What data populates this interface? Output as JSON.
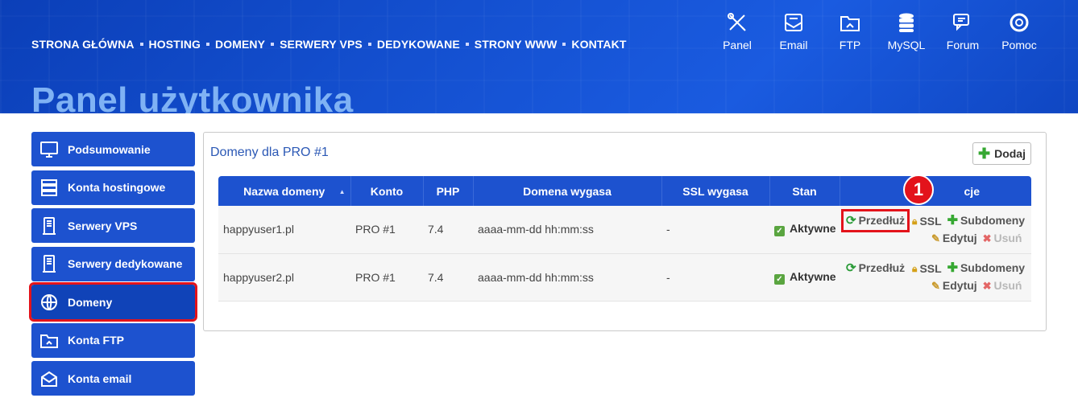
{
  "topnav": {
    "items": [
      "STRONA GŁÓWNA",
      "HOSTING",
      "DOMENY",
      "SERWERY VPS",
      "DEDYKOWANE",
      "STRONY WWW",
      "KONTAKT"
    ]
  },
  "tools": {
    "items": [
      {
        "label": "Panel",
        "icon": "tools-icon"
      },
      {
        "label": "Email",
        "icon": "email-icon"
      },
      {
        "label": "FTP",
        "icon": "ftp-folder-icon"
      },
      {
        "label": "MySQL",
        "icon": "database-icon"
      },
      {
        "label": "Forum",
        "icon": "forum-icon"
      },
      {
        "label": "Pomoc",
        "icon": "lifebuoy-icon"
      }
    ]
  },
  "page": {
    "title": "Panel użytkownika"
  },
  "sidebar": {
    "items": [
      {
        "label": "Podsumowanie",
        "icon": "monitor-icon"
      },
      {
        "label": "Konta hostingowe",
        "icon": "server-stack-icon"
      },
      {
        "label": "Serwery VPS",
        "icon": "server-icon"
      },
      {
        "label": "Serwery dedykowane",
        "icon": "server-icon"
      },
      {
        "label": "Domeny",
        "icon": "www-globe-icon",
        "active": true
      },
      {
        "label": "Konta FTP",
        "icon": "ftp-folder-icon"
      },
      {
        "label": "Konta email",
        "icon": "mail-open-icon"
      }
    ]
  },
  "panel": {
    "title": "Domeny dla PRO #1",
    "add_label": "Dodaj"
  },
  "table": {
    "headers": [
      "Nazwa domeny",
      "Konto",
      "PHP",
      "Domena wygasa",
      "SSL wygasa",
      "Stan",
      "cje"
    ],
    "rows": [
      {
        "domain": "happyuser1.pl",
        "account": "PRO #1",
        "php": "7.4",
        "expires": "aaaa-mm-dd hh:mm:ss",
        "ssl": "-",
        "status": "Aktywne"
      },
      {
        "domain": "happyuser2.pl",
        "account": "PRO #1",
        "php": "7.4",
        "expires": "aaaa-mm-dd hh:mm:ss",
        "ssl": "-",
        "status": "Aktywne"
      }
    ],
    "actions": {
      "renew": "Przedłuż",
      "ssl": "SSL",
      "subdomains": "Subdomeny",
      "edit": "Edytuj",
      "delete": "Usuń"
    }
  },
  "annotation": {
    "badge": "1"
  },
  "colors": {
    "accent": "#1d52cf",
    "highlight": "#e3131b",
    "title": "#7fb2f4"
  }
}
